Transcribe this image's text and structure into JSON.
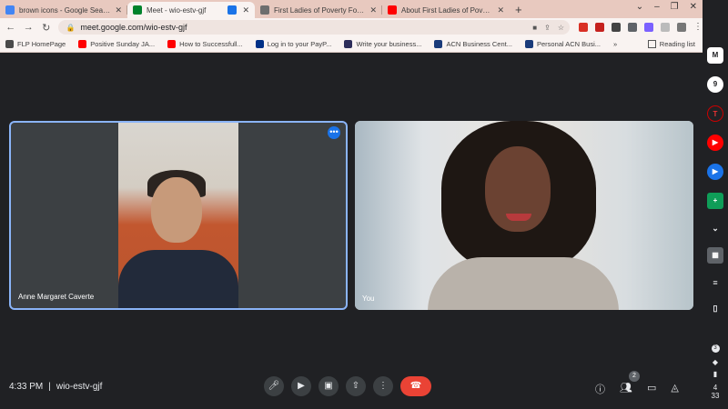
{
  "tabs": [
    {
      "title": "brown icons - Google Search",
      "favicon_color": "#4285f4"
    },
    {
      "title": "Meet - wio-estv-gjf",
      "favicon_color": "#00832d",
      "active": true
    },
    {
      "title": "First Ladies of Poverty Foundatio",
      "favicon_color": "#6e6e6e"
    },
    {
      "title": "About First Ladies of Poverty Fo",
      "favicon_color": "#ff0000"
    }
  ],
  "toolbar": {
    "url": "meet.google.com/wio-estv-gjf",
    "back_icon": "back-arrow-icon",
    "forward_icon": "forward-arrow-icon",
    "reload_icon": "reload-icon"
  },
  "bookmarks": [
    {
      "label": "FLP HomePage",
      "color": "#4a4a4a"
    },
    {
      "label": "Positive Sunday JA...",
      "color": "#ff0000"
    },
    {
      "label": "How to Successfull...",
      "color": "#ff0000"
    },
    {
      "label": "Log in to your PayP...",
      "color": "#003087"
    },
    {
      "label": "Write your business...",
      "color": "#2d2d5a"
    },
    {
      "label": "ACN Business Cent...",
      "color": "#1a3b7a"
    },
    {
      "label": "Personal ACN Busi...",
      "color": "#1a3b7a"
    }
  ],
  "reading_list": "Reading list",
  "participants": [
    {
      "name": "Anne Margaret Caverte"
    },
    {
      "name": "You"
    }
  ],
  "meeting": {
    "time": "4:33 PM",
    "separator": "|",
    "code": "wio-estv-gjf",
    "people_count": "2"
  },
  "controls": {
    "mic": "mic-icon",
    "camera": "camera-icon",
    "captions": "captions-icon",
    "present": "present-icon",
    "more": "more-vert-icon",
    "hangup": "hangup-icon"
  },
  "shelf": {
    "badge_count": "3",
    "clock_hour": "4",
    "clock_min": "33"
  }
}
